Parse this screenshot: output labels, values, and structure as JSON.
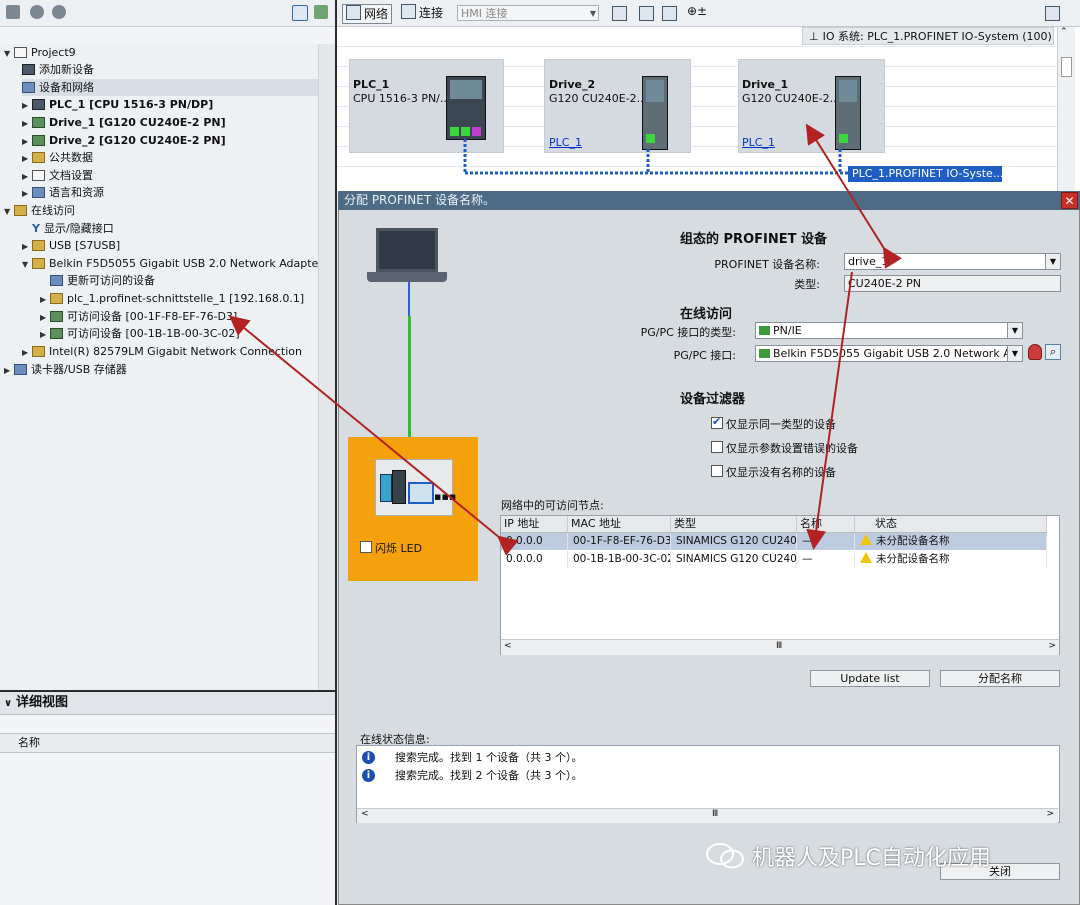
{
  "left_tree": {
    "items": [
      {
        "label": "Project9"
      },
      {
        "label": "添加新设备"
      },
      {
        "label": "设备和网络"
      },
      {
        "label": "PLC_1 [CPU 1516-3 PN/DP]"
      },
      {
        "label": "Drive_1 [G120 CU240E-2 PN]"
      },
      {
        "label": "Drive_2 [G120 CU240E-2 PN]"
      },
      {
        "label": "公共数据"
      },
      {
        "label": "文档设置"
      },
      {
        "label": "语言和资源"
      },
      {
        "label": "在线访问"
      },
      {
        "label": "显示/隐藏接口"
      },
      {
        "label": "USB [S7USB]"
      },
      {
        "label": "Belkin F5D5055 Gigabit USB 2.0 Network Adapter"
      },
      {
        "label": "更新可访问的设备"
      },
      {
        "label": "plc_1.profinet-schnittstelle_1 [192.168.0.1]"
      },
      {
        "label": "可访问设备 [00-1F-F8-EF-76-D3]"
      },
      {
        "label": "可访问设备 [00-1B-1B-00-3C-02]"
      },
      {
        "label": "Intel(R) 82579LM Gigabit Network Connection"
      },
      {
        "label": "读卡器/USB 存储器"
      }
    ]
  },
  "detail_view": {
    "title": "详细视图",
    "column_name": "名称"
  },
  "net_toolbar": {
    "network": "网络",
    "connections": "连接",
    "hmi_select": "HMI 连接"
  },
  "netview": {
    "io_system": "IO 系统: PLC_1.PROFINET IO-System (100)",
    "devices": [
      {
        "name": "PLC_1",
        "type": "CPU 1516-3 PN/...",
        "link": ""
      },
      {
        "name": "Drive_2",
        "type": "G120 CU240E-2...",
        "link": "PLC_1"
      },
      {
        "name": "Drive_1",
        "type": "G120 CU240E-2...",
        "link": "PLC_1"
      }
    ],
    "pn_label": "PLC_1.PROFINET IO-Syste..."
  },
  "dialog": {
    "title": "分配 PROFINET 设备名称。",
    "config_section": "组态的 PROFINET 设备",
    "device_name_label": "PROFINET 设备名称:",
    "device_name_value": "drive_1",
    "type_label": "类型:",
    "type_value": "CU240E-2 PN",
    "online_section": "在线访问",
    "pgpc_type_label": "PG/PC 接口的类型:",
    "pgpc_type_value": "PN/IE",
    "pgpc_if_label": "PG/PC 接口:",
    "pgpc_if_value": "Belkin F5D5055 Gigabit USB 2.0 Network Ada...",
    "filter_section": "设备过滤器",
    "filters": [
      {
        "label": "仅显示同一类型的设备",
        "checked": true
      },
      {
        "label": "仅显示参数设置错误的设备",
        "checked": false
      },
      {
        "label": "仅显示没有名称的设备",
        "checked": false
      }
    ],
    "flash_led": "闪烁 LED",
    "nodes_label": "网络中的可访问节点:",
    "table": {
      "headers": [
        "IP 地址",
        "MAC 地址",
        "类型",
        "名称",
        "状态"
      ],
      "rows": [
        {
          "ip": "0.0.0.0",
          "mac": "00-1F-F8-EF-76-D3",
          "type": "SINAMICS G120 CU240",
          "name": "—",
          "status": "未分配设备名称"
        },
        {
          "ip": "0.0.0.0",
          "mac": "00-1B-1B-00-3C-02",
          "type": "SINAMICS G120 CU240",
          "name": "—",
          "status": "未分配设备名称"
        }
      ]
    },
    "update_btn": "Update list",
    "assign_btn": "分配名称",
    "status_label": "在线状态信息:",
    "status_rows": [
      {
        "text": "搜索完成。找到 1 个设备（共 3 个）。"
      },
      {
        "text": "搜索完成。找到 2 个设备（共 3 个）。"
      }
    ],
    "close_btn": "关闭"
  },
  "watermark": "机器人及PLC自动化应用",
  "colors": {
    "orange": "#f5a10c",
    "selection": "#bccbe0",
    "pn_blue": "#1f5fc4",
    "arrow_red": "#b22222"
  }
}
